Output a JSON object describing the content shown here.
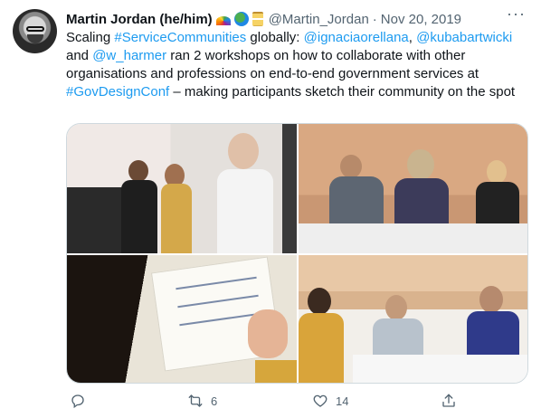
{
  "author": {
    "name": "Martin Jordan (he/him)",
    "emojis": [
      "rainbow",
      "globe",
      "hourglass"
    ],
    "handle": "@Martin_Jordan",
    "separator": "·",
    "date": "Nov 20, 2019"
  },
  "more_icon": "more-icon",
  "text": {
    "t1": "Scaling ",
    "hashtag1": "#ServiceCommunities",
    "t2": " globally: ",
    "mention1": "@ignaciaorellana",
    "t3": ", ",
    "mention2": "@kubabartwicki",
    "t4": " and ",
    "mention3": "@w_harmer",
    "t5": " ran 2 workshops on how to collaborate with other organisations and professions on end-to-end government services at ",
    "hashtag2": "#GovDesignConf",
    "t6": " – making participants sketch their community on the spot"
  },
  "media": {
    "photos": [
      "workshop-presenters-photo",
      "participants-at-tables-photo",
      "worksheet-sketching-photo",
      "participants-writing-photo"
    ]
  },
  "actions": {
    "reply": {
      "icon": "reply-icon",
      "count": ""
    },
    "retweet": {
      "icon": "retweet-icon",
      "count": "6"
    },
    "like": {
      "icon": "heart-icon",
      "count": "14"
    },
    "share": {
      "icon": "share-icon",
      "count": ""
    }
  },
  "colors": {
    "link": "#1d9bf0",
    "secondary": "#536471",
    "text": "#0f1419",
    "border": "#cfd9de"
  }
}
